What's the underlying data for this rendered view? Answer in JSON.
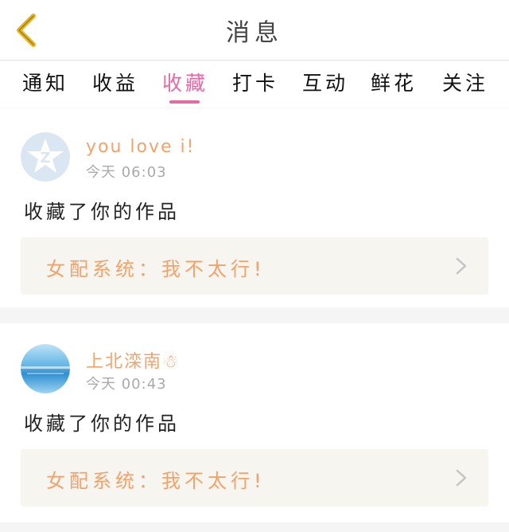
{
  "header": {
    "title": "消息"
  },
  "tabs": [
    {
      "label": "通知",
      "active": false
    },
    {
      "label": "收益",
      "active": false
    },
    {
      "label": "收藏",
      "active": true
    },
    {
      "label": "打卡",
      "active": false
    },
    {
      "label": "互动",
      "active": false
    },
    {
      "label": "鲜花",
      "active": false
    },
    {
      "label": "关注",
      "active": false
    }
  ],
  "messages": [
    {
      "username": "you love i!",
      "time": "今天 06:03",
      "action": "收藏了你的作品",
      "work_title": "女配系统：我不太行!",
      "avatar": "qzone-logo-icon"
    },
    {
      "username": "上北滦南☃",
      "time": "今天 00:43",
      "action": "收藏了你的作品",
      "work_title": "女配系统：我不太行!",
      "avatar": "sea-photo-avatar"
    }
  ],
  "colors": {
    "accent": "#e46aa6",
    "username": "#f0a36b",
    "back_arrow": "#e6b422",
    "work_bg": "#f6f5f0"
  }
}
